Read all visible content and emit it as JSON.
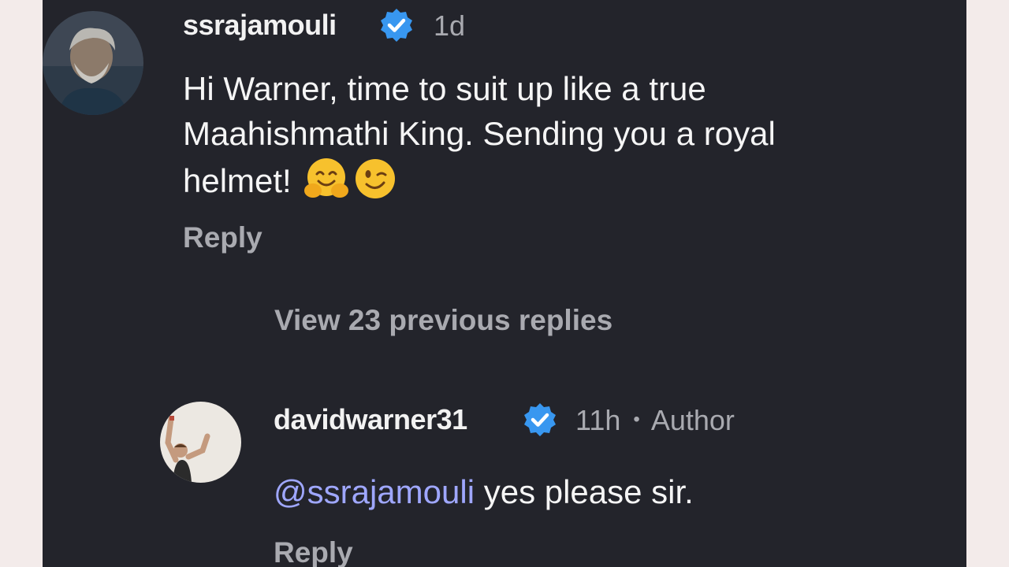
{
  "comments": [
    {
      "username": "ssrajamouli",
      "time": "1d",
      "text_lines": [
        "Hi Warner, time to suit up like a true",
        "Maahishmathi King. Sending you a royal",
        "helmet!"
      ],
      "emojis": [
        "hugging-face-emoji",
        "winking-face-emoji"
      ],
      "reply_label": "Reply"
    }
  ],
  "view_previous_replies": "View 23 previous replies",
  "reply": {
    "username": "davidwarner31",
    "time": "11h",
    "separator": "•",
    "author_label": "Author",
    "mention": "@ssrajamouli",
    "text": " yes please sir.",
    "reply_label": "Reply"
  },
  "colors": {
    "background": "#23242b",
    "verified_badge": "#3897f0",
    "mention": "#9fa7ff",
    "muted_text": "#a9aab0"
  }
}
